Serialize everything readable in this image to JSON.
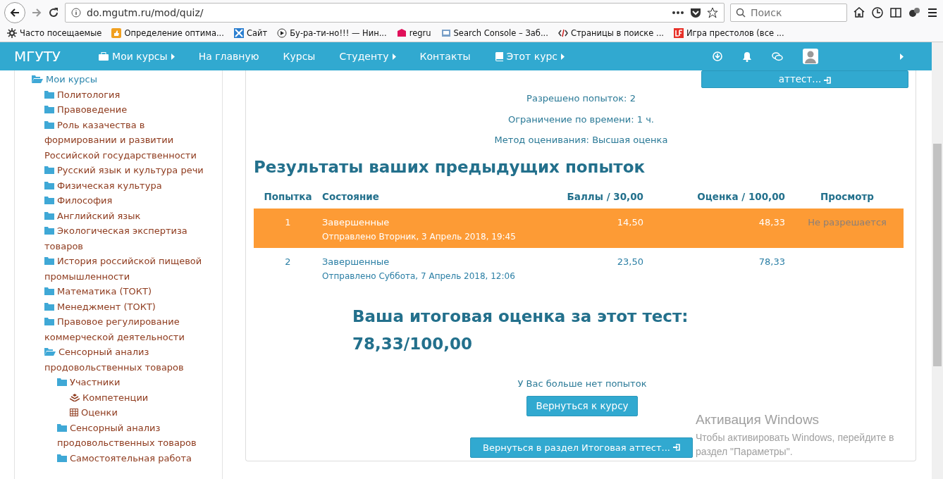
{
  "browser": {
    "url": "do.mgutm.ru/mod/quiz/",
    "search": {
      "placeholder": "Поиск"
    },
    "bookmarks": [
      {
        "label": "Часто посещаемые"
      },
      {
        "label": "Определение оптима..."
      },
      {
        "label": "Сайт"
      },
      {
        "label": "Бу-ра-ти-но!!! — Нин..."
      },
      {
        "label": "regru"
      },
      {
        "label": "Search Console – Заб..."
      },
      {
        "label": "Страницы в поиске ..."
      },
      {
        "label": "Игра престолов (все ..."
      }
    ]
  },
  "navbar": {
    "brand": "МГУТУ",
    "items": [
      {
        "label": "Мои курсы",
        "kind": "briefcase",
        "submenu": true
      },
      {
        "label": "На главную",
        "kind": "plain",
        "submenu": false
      },
      {
        "label": "Курсы",
        "kind": "plain",
        "submenu": false
      },
      {
        "label": "Студенту",
        "kind": "plain",
        "submenu": true
      },
      {
        "label": "Контакты",
        "kind": "plain",
        "submenu": false
      },
      {
        "label": "Этот курс",
        "kind": "book",
        "submenu": true
      }
    ]
  },
  "sidebar": {
    "items": [
      {
        "label": "Мои курсы",
        "kind": "folder-open",
        "children": [
          {
            "label": "Политология",
            "kind": "folder"
          },
          {
            "label": "Правоведение",
            "kind": "folder"
          },
          {
            "label": "Роль казачества в формировании и развитии Российской государственности",
            "kind": "folder"
          },
          {
            "label": "Русский язык и культура речи",
            "kind": "folder"
          },
          {
            "label": "Физическая культура",
            "kind": "folder"
          },
          {
            "label": "Философия",
            "kind": "folder"
          },
          {
            "label": "Английский язык",
            "kind": "folder"
          },
          {
            "label": "Экологическая экспертиза товаров",
            "kind": "folder"
          },
          {
            "label": "История российской пищевой промышленности",
            "kind": "folder"
          },
          {
            "label": "Математика (ТОКТ)",
            "kind": "folder"
          },
          {
            "label": "Менеджмент (ТОКТ)",
            "kind": "folder"
          },
          {
            "label": "Правовое регулирование коммерческой деятельности",
            "kind": "folder"
          },
          {
            "label": "Сенсорный анализ продовольственных товаров",
            "kind": "folder-open",
            "children": [
              {
                "label": "Участники",
                "kind": "folder",
                "children": [
                  {
                    "label": "Компетенции",
                    "kind": "competencies"
                  },
                  {
                    "label": "Оценки",
                    "kind": "grades"
                  }
                ]
              },
              {
                "label": "Сенсорный анализ продовольственных товаров",
                "kind": "folder"
              },
              {
                "label": "Самостоятельная работа",
                "kind": "folder"
              }
            ]
          }
        ]
      }
    ]
  },
  "quiz": {
    "top_button": "аттест...",
    "info": [
      "Разрешено попыток: 2",
      "Ограничение по времени: 1 ч.",
      "Метод оценивания: Высшая оценка"
    ],
    "results_title": "Результаты ваших предыдущих попыток",
    "table": {
      "columns": [
        "Попытка",
        "Состояние",
        "Баллы / 30,00",
        "Оценка / 100,00",
        "Просмотр"
      ],
      "rows": [
        {
          "attempt": "1",
          "state": "Завершенные",
          "submitted": "Отправлено Вторник, 3 Апрель 2018, 19:45",
          "score": "14,50",
          "grade": "48,33",
          "review": "Не разрешается",
          "selected": true
        },
        {
          "attempt": "2",
          "state": "Завершенные",
          "submitted": "Отправлено Суббота, 7 Апрель 2018, 12:06",
          "score": "23,50",
          "grade": "78,33",
          "selected": false
        }
      ]
    },
    "final_grade_label": "Ваша итоговая оценка за этот тест:",
    "final_grade": "78,33/100,00",
    "no_attempts": "У Вас больше нет попыток",
    "buttons": [
      "Вернуться к курсу",
      "Вернуться в раздел Итоговая аттест..."
    ]
  },
  "windows_activation": {
    "title": "Активация Windows",
    "text": "Чтобы активировать Windows, перейдите в раздел \"Параметры\"."
  }
}
